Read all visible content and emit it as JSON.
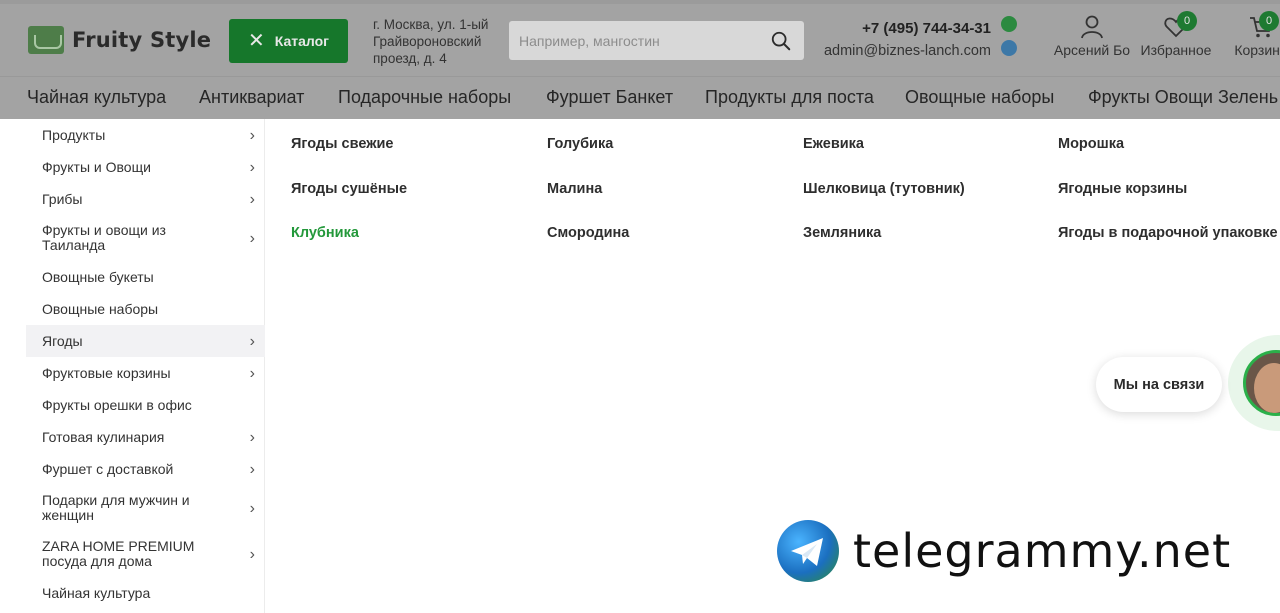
{
  "header": {
    "logo_text": "Fruity Style",
    "catalog_label": "Каталог",
    "address": "г. Москва, ул. 1-ый Грайвороновский проезд, д. 4",
    "search_placeholder": "Например, мангостин",
    "phone": "+7 (495) 744-34-31",
    "email": "admin@biznes-lanch.com",
    "account_label": "Арсений Бо",
    "favorites_label": "Избранное",
    "favorites_count": "0",
    "cart_label": "Корзина",
    "cart_count": "0"
  },
  "nav": {
    "items": [
      "Чайная культура",
      "Антиквариат",
      "Подарочные наборы",
      "Фуршет Банкет",
      "Продукты для поста",
      "Овощные наборы",
      "Фрукты Овощи Зелень"
    ]
  },
  "sidebar": {
    "items": [
      {
        "label": "Продукты",
        "chevron": true
      },
      {
        "label": "Фрукты и Овощи",
        "chevron": true
      },
      {
        "label": "Грибы",
        "chevron": true
      },
      {
        "label": "Фрукты и овощи из Таиланда",
        "chevron": true
      },
      {
        "label": "Овощные букеты",
        "chevron": false
      },
      {
        "label": "Овощные наборы",
        "chevron": false
      },
      {
        "label": "Ягоды",
        "chevron": true,
        "active": true
      },
      {
        "label": "Фруктовые корзины",
        "chevron": true
      },
      {
        "label": "Фрукты орешки в офис",
        "chevron": false
      },
      {
        "label": "Готовая кулинария",
        "chevron": true
      },
      {
        "label": "Фуршет с доставкой",
        "chevron": true
      },
      {
        "label": "Подарки для мужчин и женщин",
        "chevron": true
      },
      {
        "label": "ZARA HOME PREMIUM посуда для дома",
        "chevron": true
      },
      {
        "label": "Чайная культура",
        "chevron": false
      }
    ]
  },
  "submenu": {
    "links": [
      "Ягоды свежие",
      "Голубика",
      "Ежевика",
      "Морошка",
      "Ягоды сушёные",
      "Малина",
      "Шелковица (тутовник)",
      "Ягодные корзины",
      "Клубника",
      "Смородина",
      "Земляника",
      "Ягоды в подарочной упаковке"
    ],
    "active_index": 8
  },
  "chat": {
    "label": "Мы на связи"
  },
  "watermark": {
    "text": "telegrammy.net"
  },
  "colors": {
    "accent_green": "#23983a",
    "catalog_green": "#16772b",
    "header_dim": "#a3a3a3"
  }
}
